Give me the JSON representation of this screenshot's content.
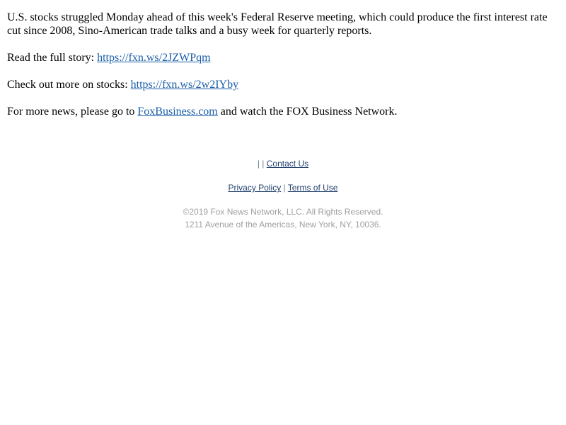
{
  "story": {
    "intro": "U.S. stocks struggled Monday ahead of this week's Federal Reserve meeting, which could produce the first interest rate cut since 2008, Sino-American trade talks and a busy week for quarterly reports.",
    "read_full_prefix": "Read the full story: ",
    "read_full_link": "https://fxn.ws/2JZWPqm",
    "more_stocks_prefix": "Check out more on stocks: ",
    "more_stocks_link": "https://fxn.ws/2w2IYby",
    "more_news_prefix": "For more news, please go to ",
    "more_news_link": "FoxBusiness.com",
    "more_news_suffix": " and watch the FOX Business Network."
  },
  "footer": {
    "separators_row1": "| | ",
    "contact_us": "Contact Us",
    "privacy_policy": "Privacy Policy",
    "separator_row2": " | ",
    "terms_of_use": "Terms of Use",
    "copyright": "©2019 Fox News Network, LLC. All Rights Reserved.",
    "address": "1211 Avenue of the Americas, New York, NY, 10036."
  },
  "colors": {
    "story_link": "#1a5ea8",
    "footer_link": "#23406e",
    "legal_text": "#a0a0a0"
  }
}
